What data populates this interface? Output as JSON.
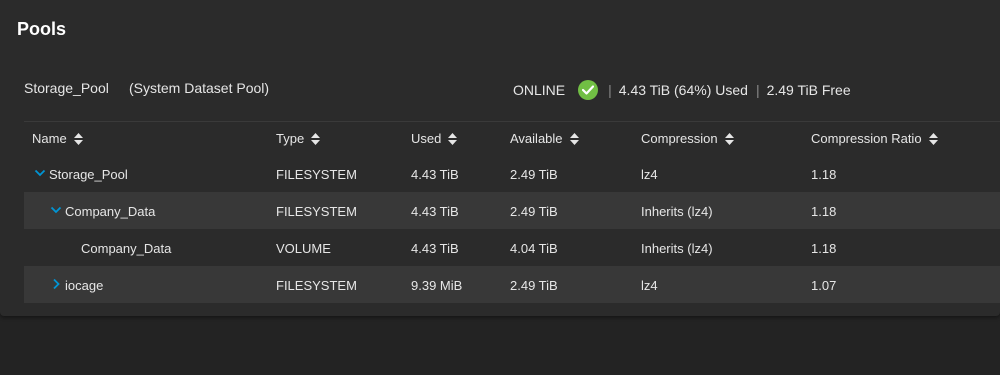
{
  "page": {
    "title": "Pools"
  },
  "pool": {
    "name": "Storage_Pool",
    "subtitle": "(System Dataset Pool)",
    "status": "ONLINE",
    "used": "4.43 TiB (64%) Used",
    "free": "2.49 TiB Free",
    "separator": "|",
    "status_color": "#71bf44"
  },
  "table": {
    "columns": [
      "Name",
      "Type",
      "Used",
      "Available",
      "Compression",
      "Compression Ratio"
    ],
    "rows": [
      {
        "name": "Storage_Pool",
        "type": "FILESYSTEM",
        "used": "4.43 TiB",
        "available": "2.49 TiB",
        "compression": "lz4",
        "ratio": "1.18",
        "expander": "chevron-down"
      },
      {
        "name": "Company_Data",
        "type": "FILESYSTEM",
        "used": "4.43 TiB",
        "available": "2.49 TiB",
        "compression": "Inherits (lz4)",
        "ratio": "1.18",
        "expander": "chevron-down"
      },
      {
        "name": "Company_Data",
        "type": "VOLUME",
        "used": "4.43 TiB",
        "available": "4.04 TiB",
        "compression": "Inherits (lz4)",
        "ratio": "1.18",
        "expander": ""
      },
      {
        "name": "iocage",
        "type": "FILESYSTEM",
        "used": "9.39 MiB",
        "available": "2.49 TiB",
        "compression": "lz4",
        "ratio": "1.07",
        "expander": "chevron-right"
      }
    ]
  },
  "colors": {
    "accent": "#0095d5",
    "row_alt": "#383838",
    "card": "#2b2b2b",
    "background": "#232323"
  }
}
